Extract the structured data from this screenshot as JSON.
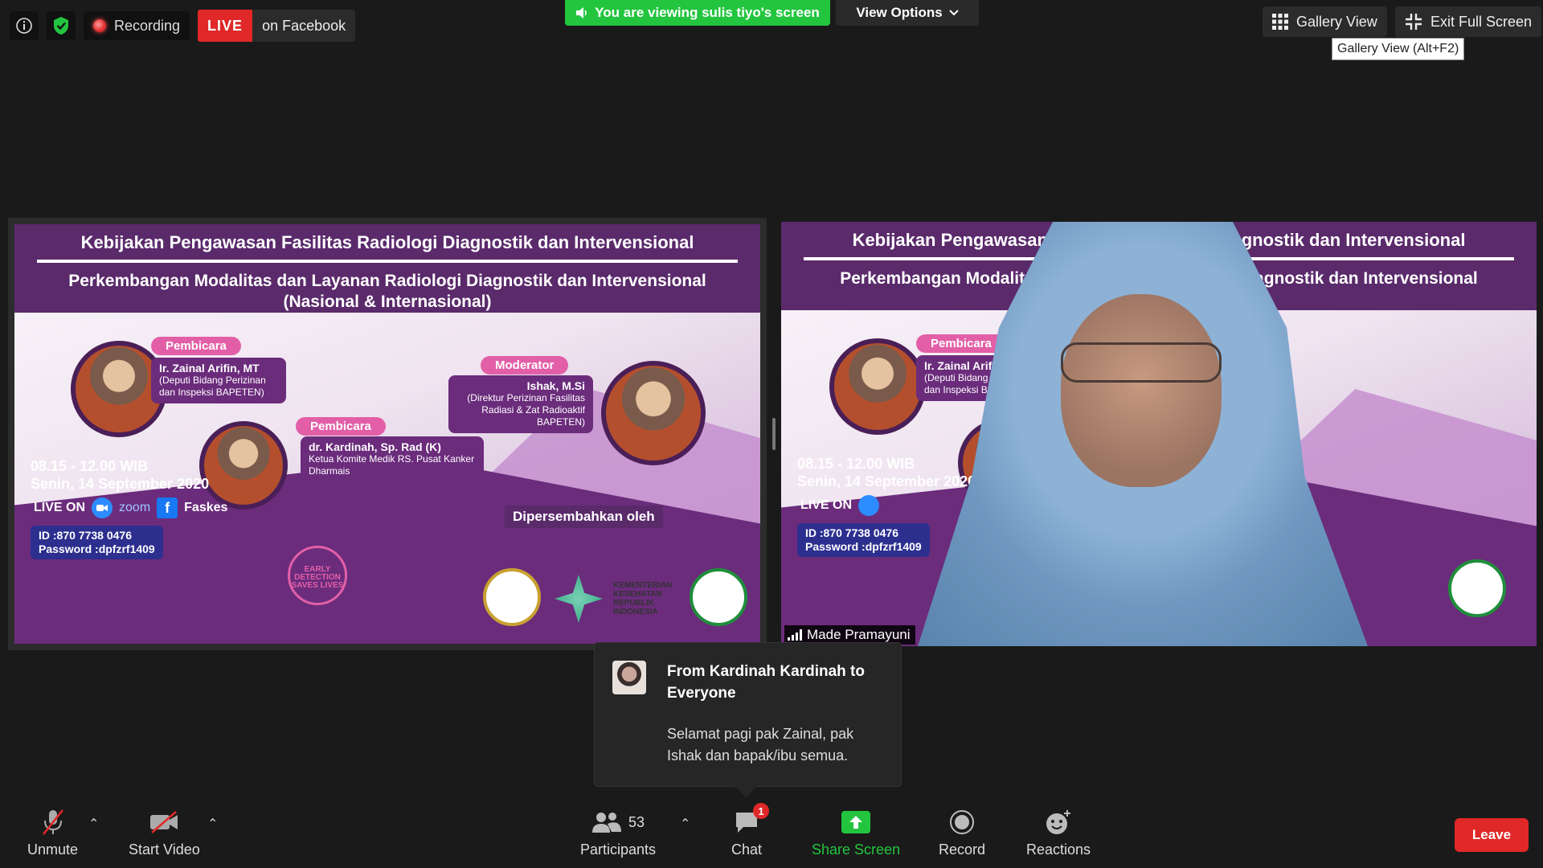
{
  "topbar": {
    "recording_label": "Recording",
    "live_badge": "LIVE",
    "live_text": "on Facebook",
    "viewing_banner": "You are viewing sulis tiyo's screen",
    "view_options": "View Options",
    "gallery_view": "Gallery View",
    "exit_full_screen": "Exit Full Screen",
    "tooltip": "Gallery View (Alt+F2)"
  },
  "slide": {
    "title1": "Kebijakan Pengawasan Fasilitas Radiologi Diagnostik dan Intervensional",
    "title2a": "Perkembangan Modalitas dan Layanan Radiologi Diagnostik dan Intervensional",
    "title2b": "(Nasional & Internasional)",
    "pembicara": "Pembicara",
    "speaker1_name": "Ir. Zainal Arifin, MT",
    "speaker1_role": "(Deputi Bidang Perizinan dan Inspeksi BAPETEN)",
    "speaker2_name": "dr. Kardinah, Sp. Rad (K)",
    "speaker2_role": "Ketua Komite Medik RS. Pusat Kanker Dharmais",
    "moderator": "Moderator",
    "moderator_name": "Ishak, M.Si",
    "moderator_role": "(Direktur Perizinan Fasilitas Radiasi & Zat Radioaktif BAPETEN)",
    "time": "08.15 - 12.00 WIB",
    "date": "Senin, 14 September 2020",
    "live_on": "LIVE ON",
    "zoom": "zoom",
    "faskes": "Faskes",
    "id_line": "ID          :870 7738 0476",
    "password_line": "Password :dpfzrf1409",
    "presented_by": "Dipersembahkan oleh",
    "ribbon": "EARLY DETECTION SAVES LIVES",
    "kemenkes": "KEMENTERIAN KESEHATAN REPUBLIK INDONESIA"
  },
  "right_tile": {
    "participant_name": "Made Pramayuni"
  },
  "chat_popup": {
    "from": "From Kardinah Kardinah to Everyone",
    "message": "Selamat pagi pak Zainal, pak Ishak dan bapak/ibu semua."
  },
  "toolbar": {
    "unmute": "Unmute",
    "start_video": "Start Video",
    "participants": "Participants",
    "participants_count": "53",
    "chat": "Chat",
    "chat_badge": "1",
    "share_screen": "Share Screen",
    "record": "Record",
    "reactions": "Reactions",
    "leave": "Leave"
  },
  "colors": {
    "live_red": "#e02828",
    "share_green": "#23c53f",
    "slide_purple": "#5a2a6b",
    "pill_pink": "#e25fa7"
  }
}
